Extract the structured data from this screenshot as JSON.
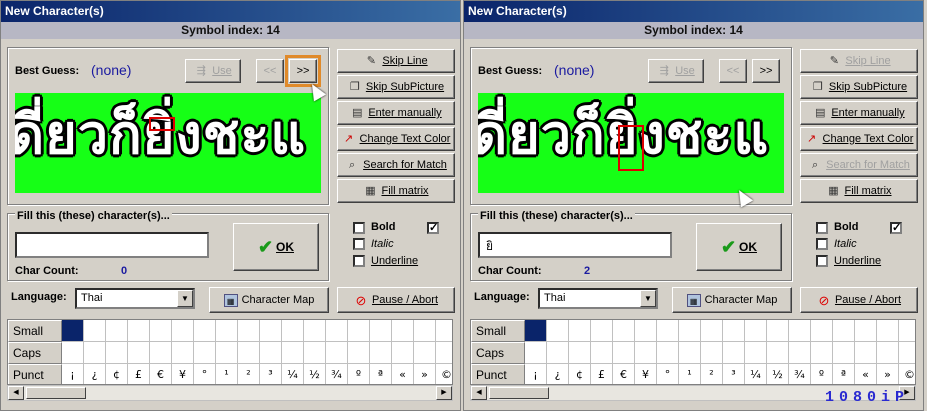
{
  "windows": [
    {
      "title": "New Character(s)",
      "symbol_index": "Symbol index: 14",
      "best_guess_label": "Best Guess:",
      "best_guess_value": "(none)",
      "use_label": "Use",
      "prev_label": "<<",
      "next_label": ">>",
      "actions": [
        "Skip Line",
        "Skip SubPicture",
        "Enter manually",
        "Change Text Color",
        "Search for Match",
        "Fill matrix"
      ],
      "preview_text": "ดี่ยวก็ยิ่งชะแ",
      "fill_label": "Fill this (these) character(s)...",
      "fill_value": "",
      "char_count_label": "Char Count:",
      "char_count": "0",
      "ok_label": "OK",
      "bold_label": "Bold",
      "italic_label": "Italic",
      "underline_label": "Underline",
      "language_label": "Language:",
      "language_value": "Thai",
      "charmap_label": "Character Map",
      "pause_label": "Pause / Abort",
      "rows": [
        "Small",
        "Caps",
        "Punct"
      ],
      "punct": [
        "¡",
        "¿",
        "¢",
        "£",
        "€",
        "¥",
        "°",
        "¹",
        "²",
        "³",
        "¼",
        "½",
        "¾",
        "º",
        "ª",
        "«",
        "»",
        "©"
      ]
    },
    {
      "title": "New Character(s)",
      "symbol_index": "Symbol index: 14",
      "best_guess_label": "Best Guess:",
      "best_guess_value": "(none)",
      "use_label": "Use",
      "prev_label": "<<",
      "next_label": ">>",
      "actions": [
        "Skip Line",
        "Skip SubPicture",
        "Enter manually",
        "Change Text Color",
        "Search for Match",
        "Fill matrix"
      ],
      "preview_text": "ดี่ยวก็ยิ่งชะแ",
      "fill_label": "Fill this (these) character(s)...",
      "fill_value": "ยิ",
      "char_count_label": "Char Count:",
      "char_count": "2",
      "ok_label": "OK",
      "bold_label": "Bold",
      "italic_label": "Italic",
      "underline_label": "Underline",
      "language_label": "Language:",
      "language_value": "Thai",
      "charmap_label": "Character Map",
      "pause_label": "Pause / Abort",
      "rows": [
        "Small",
        "Caps",
        "Punct"
      ],
      "punct": [
        "¡",
        "¿",
        "¢",
        "£",
        "€",
        "¥",
        "°",
        "¹",
        "²",
        "³",
        "¼",
        "½",
        "¾",
        "º",
        "ª",
        "«",
        "»",
        "©"
      ]
    }
  ],
  "watermark": "1080iP",
  "colors": {
    "titlebar": "#0a246a",
    "preview_bg": "#16ff16",
    "accent": "#1a1aa0",
    "next_highlight": "#e08a2a"
  }
}
